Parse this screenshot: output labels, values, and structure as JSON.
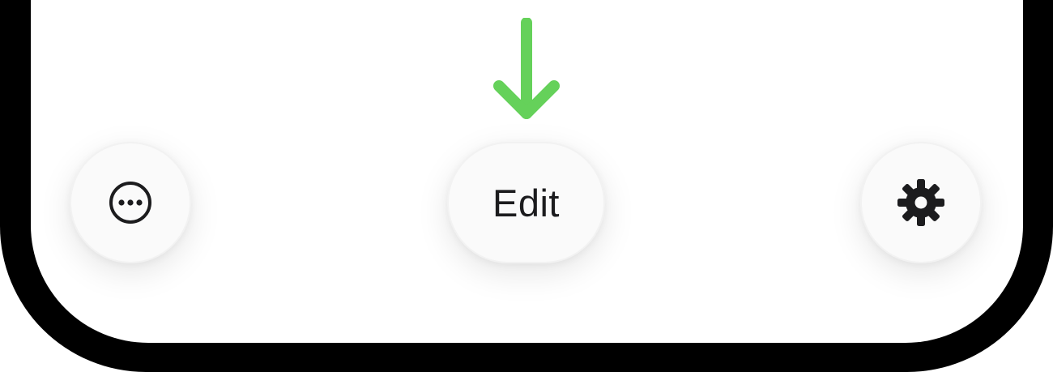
{
  "toolbar": {
    "more": {
      "icon": "ellipsis-circle-icon"
    },
    "edit": {
      "label": "Edit"
    },
    "settings": {
      "icon": "gear-icon"
    }
  },
  "annotation": {
    "icon": "arrow-down-icon",
    "color": "#65d15a"
  },
  "colors": {
    "frame": "#000000",
    "screen": "#ffffff",
    "button_bg": "#fafafa",
    "text": "#1c1c1e"
  }
}
